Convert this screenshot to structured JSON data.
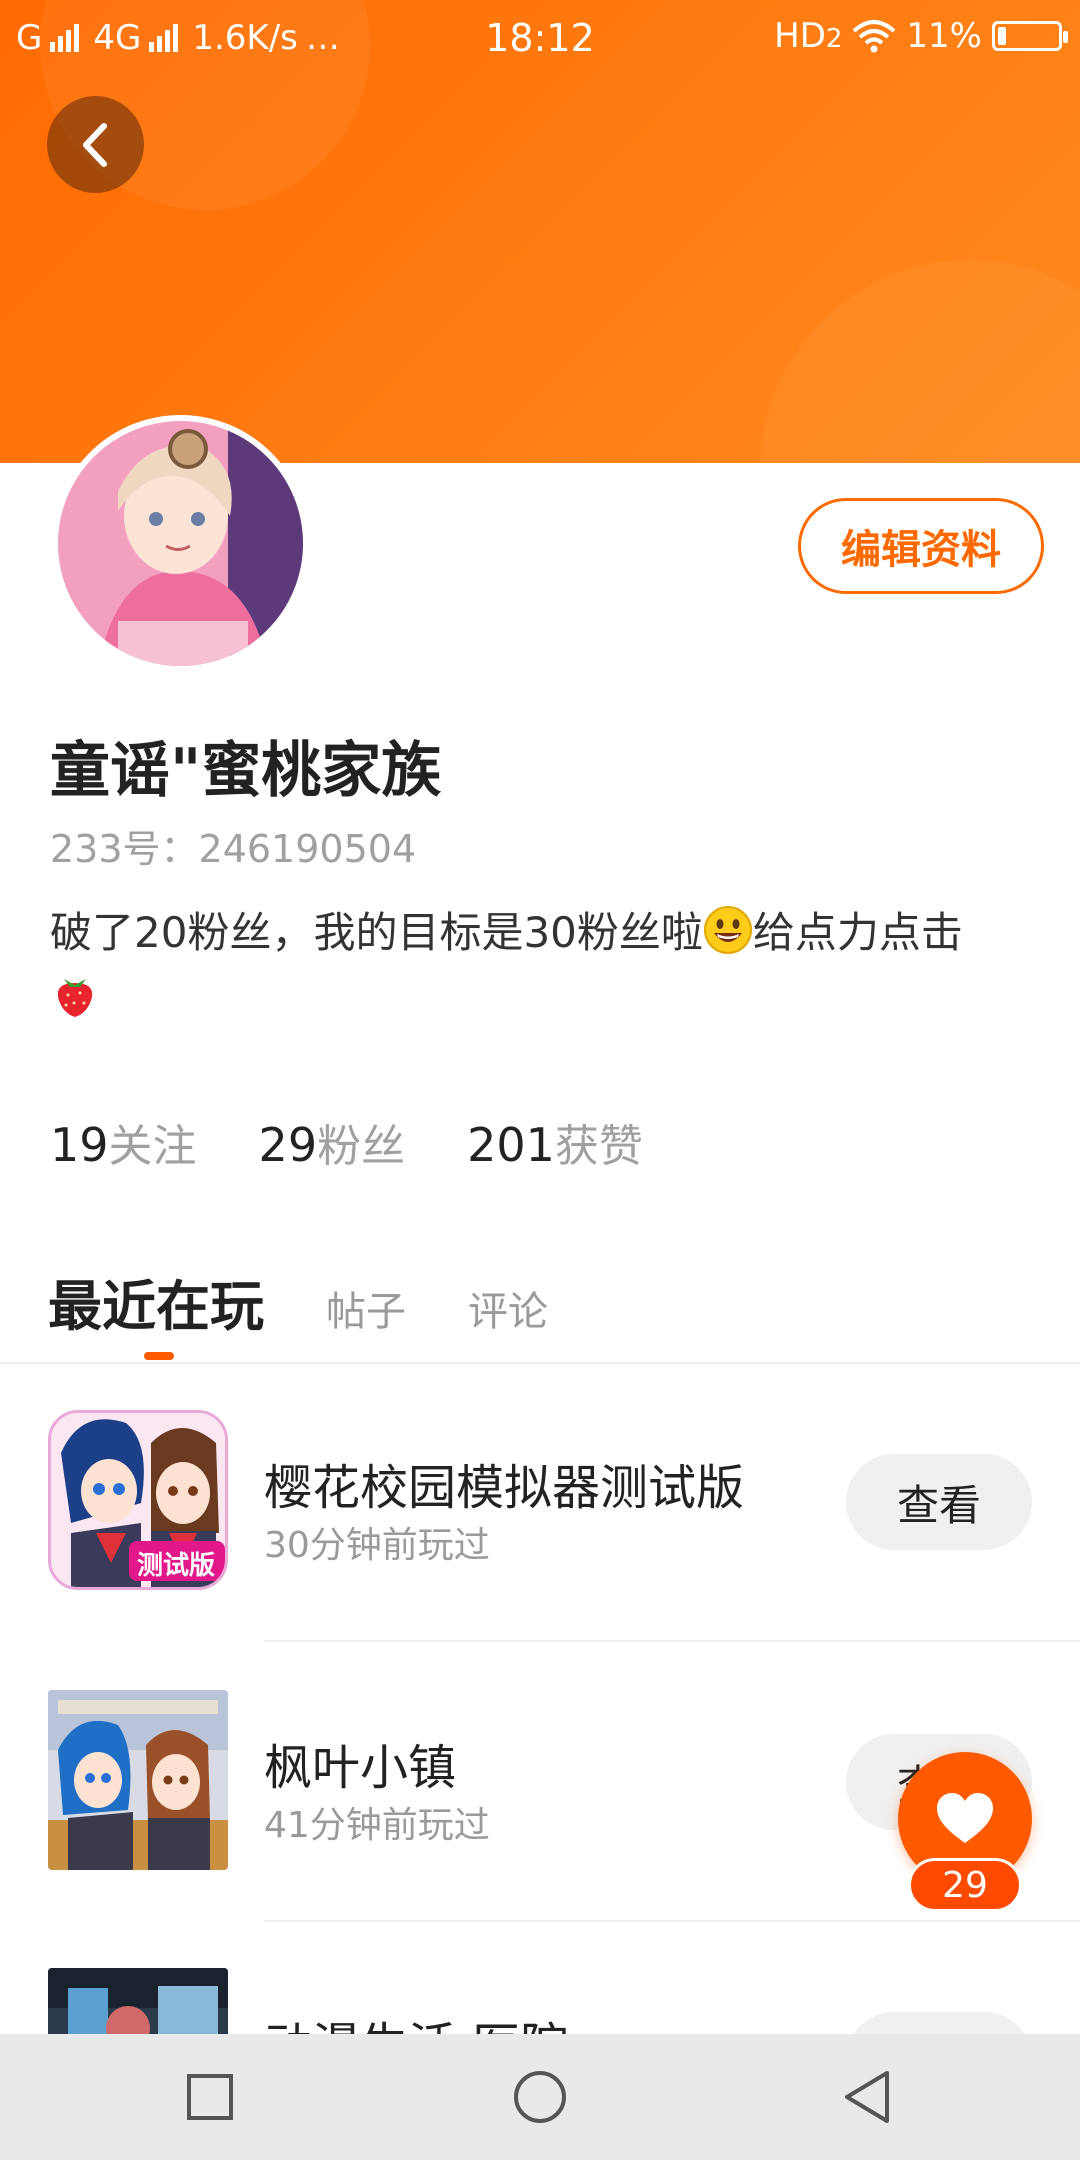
{
  "status_bar": {
    "carrier": "G",
    "network": "4G",
    "speed": "1.6K/s",
    "more": "…",
    "time": "18:12",
    "hd": "HD",
    "hd_sub": "2",
    "battery": "11%"
  },
  "profile": {
    "username": "童谣\"蜜桃家族",
    "id_label": "233号：",
    "id_value": "246190504",
    "bio_part1": "破了20粉丝，我的目标是30粉丝啦",
    "bio_part2": "给点力点击",
    "edit_button": "编辑资料"
  },
  "stats": [
    {
      "value": "19",
      "label": "关注"
    },
    {
      "value": "29",
      "label": "粉丝"
    },
    {
      "value": "201",
      "label": "获赞"
    }
  ],
  "tabs": {
    "active": "最近在玩",
    "posts": "帖子",
    "comments": "评论"
  },
  "games": [
    {
      "title": "樱花校园模拟器测试版",
      "time": "30分钟前玩过",
      "button": "查看",
      "badge": "测试版"
    },
    {
      "title": "枫叶小镇",
      "time": "41分钟前玩过",
      "button": "查看"
    },
    {
      "title": "动漫生活:医院",
      "time": "",
      "button": ""
    }
  ],
  "like": {
    "count": "29"
  },
  "colors": {
    "accent": "#ff6a00",
    "like": "#ff5a00"
  }
}
